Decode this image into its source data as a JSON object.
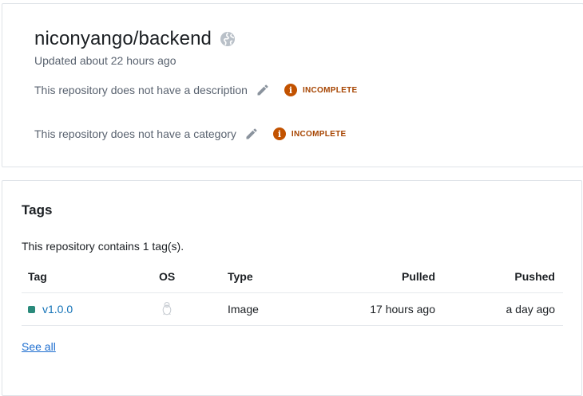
{
  "repository": {
    "name": "niconyango/backend",
    "visibility_icon": "globe-icon",
    "updated": "Updated about 22 hours ago",
    "description_text": "This repository does not have a description",
    "category_text": "This repository does not have a category",
    "incomplete_label": "INCOMPLETE"
  },
  "tags": {
    "heading": "Tags",
    "summary": "This repository contains 1 tag(s).",
    "columns": {
      "tag": "Tag",
      "os": "OS",
      "type": "Type",
      "pulled": "Pulled",
      "pushed": "Pushed"
    },
    "rows": [
      {
        "tag": "v1.0.0",
        "os_icon": "linux-icon",
        "type": "Image",
        "pulled": "17 hours ago",
        "pushed": "a day ago"
      }
    ],
    "see_all": "See all"
  },
  "colors": {
    "incomplete": "#c25200",
    "tag_status": "#2a8a7b",
    "link": "#1473b8"
  }
}
